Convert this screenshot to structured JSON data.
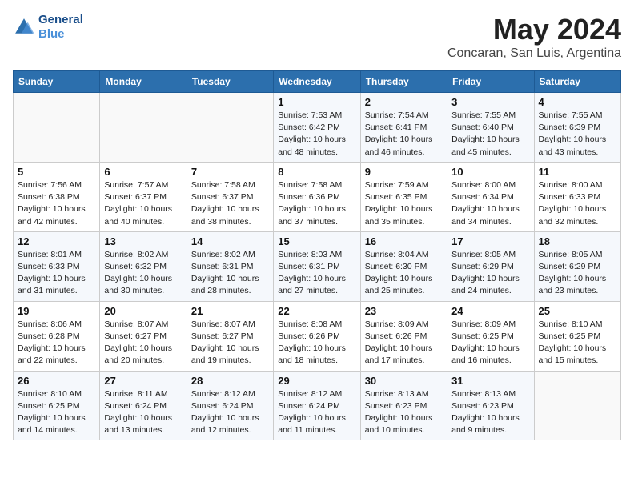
{
  "header": {
    "logo_line1": "General",
    "logo_line2": "Blue",
    "title": "May 2024",
    "subtitle": "Concaran, San Luis, Argentina"
  },
  "days_of_week": [
    "Sunday",
    "Monday",
    "Tuesday",
    "Wednesday",
    "Thursday",
    "Friday",
    "Saturday"
  ],
  "weeks": [
    [
      {
        "day": "",
        "info": ""
      },
      {
        "day": "",
        "info": ""
      },
      {
        "day": "",
        "info": ""
      },
      {
        "day": "1",
        "info": "Sunrise: 7:53 AM\nSunset: 6:42 PM\nDaylight: 10 hours\nand 48 minutes."
      },
      {
        "day": "2",
        "info": "Sunrise: 7:54 AM\nSunset: 6:41 PM\nDaylight: 10 hours\nand 46 minutes."
      },
      {
        "day": "3",
        "info": "Sunrise: 7:55 AM\nSunset: 6:40 PM\nDaylight: 10 hours\nand 45 minutes."
      },
      {
        "day": "4",
        "info": "Sunrise: 7:55 AM\nSunset: 6:39 PM\nDaylight: 10 hours\nand 43 minutes."
      }
    ],
    [
      {
        "day": "5",
        "info": "Sunrise: 7:56 AM\nSunset: 6:38 PM\nDaylight: 10 hours\nand 42 minutes."
      },
      {
        "day": "6",
        "info": "Sunrise: 7:57 AM\nSunset: 6:37 PM\nDaylight: 10 hours\nand 40 minutes."
      },
      {
        "day": "7",
        "info": "Sunrise: 7:58 AM\nSunset: 6:37 PM\nDaylight: 10 hours\nand 38 minutes."
      },
      {
        "day": "8",
        "info": "Sunrise: 7:58 AM\nSunset: 6:36 PM\nDaylight: 10 hours\nand 37 minutes."
      },
      {
        "day": "9",
        "info": "Sunrise: 7:59 AM\nSunset: 6:35 PM\nDaylight: 10 hours\nand 35 minutes."
      },
      {
        "day": "10",
        "info": "Sunrise: 8:00 AM\nSunset: 6:34 PM\nDaylight: 10 hours\nand 34 minutes."
      },
      {
        "day": "11",
        "info": "Sunrise: 8:00 AM\nSunset: 6:33 PM\nDaylight: 10 hours\nand 32 minutes."
      }
    ],
    [
      {
        "day": "12",
        "info": "Sunrise: 8:01 AM\nSunset: 6:33 PM\nDaylight: 10 hours\nand 31 minutes."
      },
      {
        "day": "13",
        "info": "Sunrise: 8:02 AM\nSunset: 6:32 PM\nDaylight: 10 hours\nand 30 minutes."
      },
      {
        "day": "14",
        "info": "Sunrise: 8:02 AM\nSunset: 6:31 PM\nDaylight: 10 hours\nand 28 minutes."
      },
      {
        "day": "15",
        "info": "Sunrise: 8:03 AM\nSunset: 6:31 PM\nDaylight: 10 hours\nand 27 minutes."
      },
      {
        "day": "16",
        "info": "Sunrise: 8:04 AM\nSunset: 6:30 PM\nDaylight: 10 hours\nand 25 minutes."
      },
      {
        "day": "17",
        "info": "Sunrise: 8:05 AM\nSunset: 6:29 PM\nDaylight: 10 hours\nand 24 minutes."
      },
      {
        "day": "18",
        "info": "Sunrise: 8:05 AM\nSunset: 6:29 PM\nDaylight: 10 hours\nand 23 minutes."
      }
    ],
    [
      {
        "day": "19",
        "info": "Sunrise: 8:06 AM\nSunset: 6:28 PM\nDaylight: 10 hours\nand 22 minutes."
      },
      {
        "day": "20",
        "info": "Sunrise: 8:07 AM\nSunset: 6:27 PM\nDaylight: 10 hours\nand 20 minutes."
      },
      {
        "day": "21",
        "info": "Sunrise: 8:07 AM\nSunset: 6:27 PM\nDaylight: 10 hours\nand 19 minutes."
      },
      {
        "day": "22",
        "info": "Sunrise: 8:08 AM\nSunset: 6:26 PM\nDaylight: 10 hours\nand 18 minutes."
      },
      {
        "day": "23",
        "info": "Sunrise: 8:09 AM\nSunset: 6:26 PM\nDaylight: 10 hours\nand 17 minutes."
      },
      {
        "day": "24",
        "info": "Sunrise: 8:09 AM\nSunset: 6:25 PM\nDaylight: 10 hours\nand 16 minutes."
      },
      {
        "day": "25",
        "info": "Sunrise: 8:10 AM\nSunset: 6:25 PM\nDaylight: 10 hours\nand 15 minutes."
      }
    ],
    [
      {
        "day": "26",
        "info": "Sunrise: 8:10 AM\nSunset: 6:25 PM\nDaylight: 10 hours\nand 14 minutes."
      },
      {
        "day": "27",
        "info": "Sunrise: 8:11 AM\nSunset: 6:24 PM\nDaylight: 10 hours\nand 13 minutes."
      },
      {
        "day": "28",
        "info": "Sunrise: 8:12 AM\nSunset: 6:24 PM\nDaylight: 10 hours\nand 12 minutes."
      },
      {
        "day": "29",
        "info": "Sunrise: 8:12 AM\nSunset: 6:24 PM\nDaylight: 10 hours\nand 11 minutes."
      },
      {
        "day": "30",
        "info": "Sunrise: 8:13 AM\nSunset: 6:23 PM\nDaylight: 10 hours\nand 10 minutes."
      },
      {
        "day": "31",
        "info": "Sunrise: 8:13 AM\nSunset: 6:23 PM\nDaylight: 10 hours\nand 9 minutes."
      },
      {
        "day": "",
        "info": ""
      }
    ]
  ]
}
